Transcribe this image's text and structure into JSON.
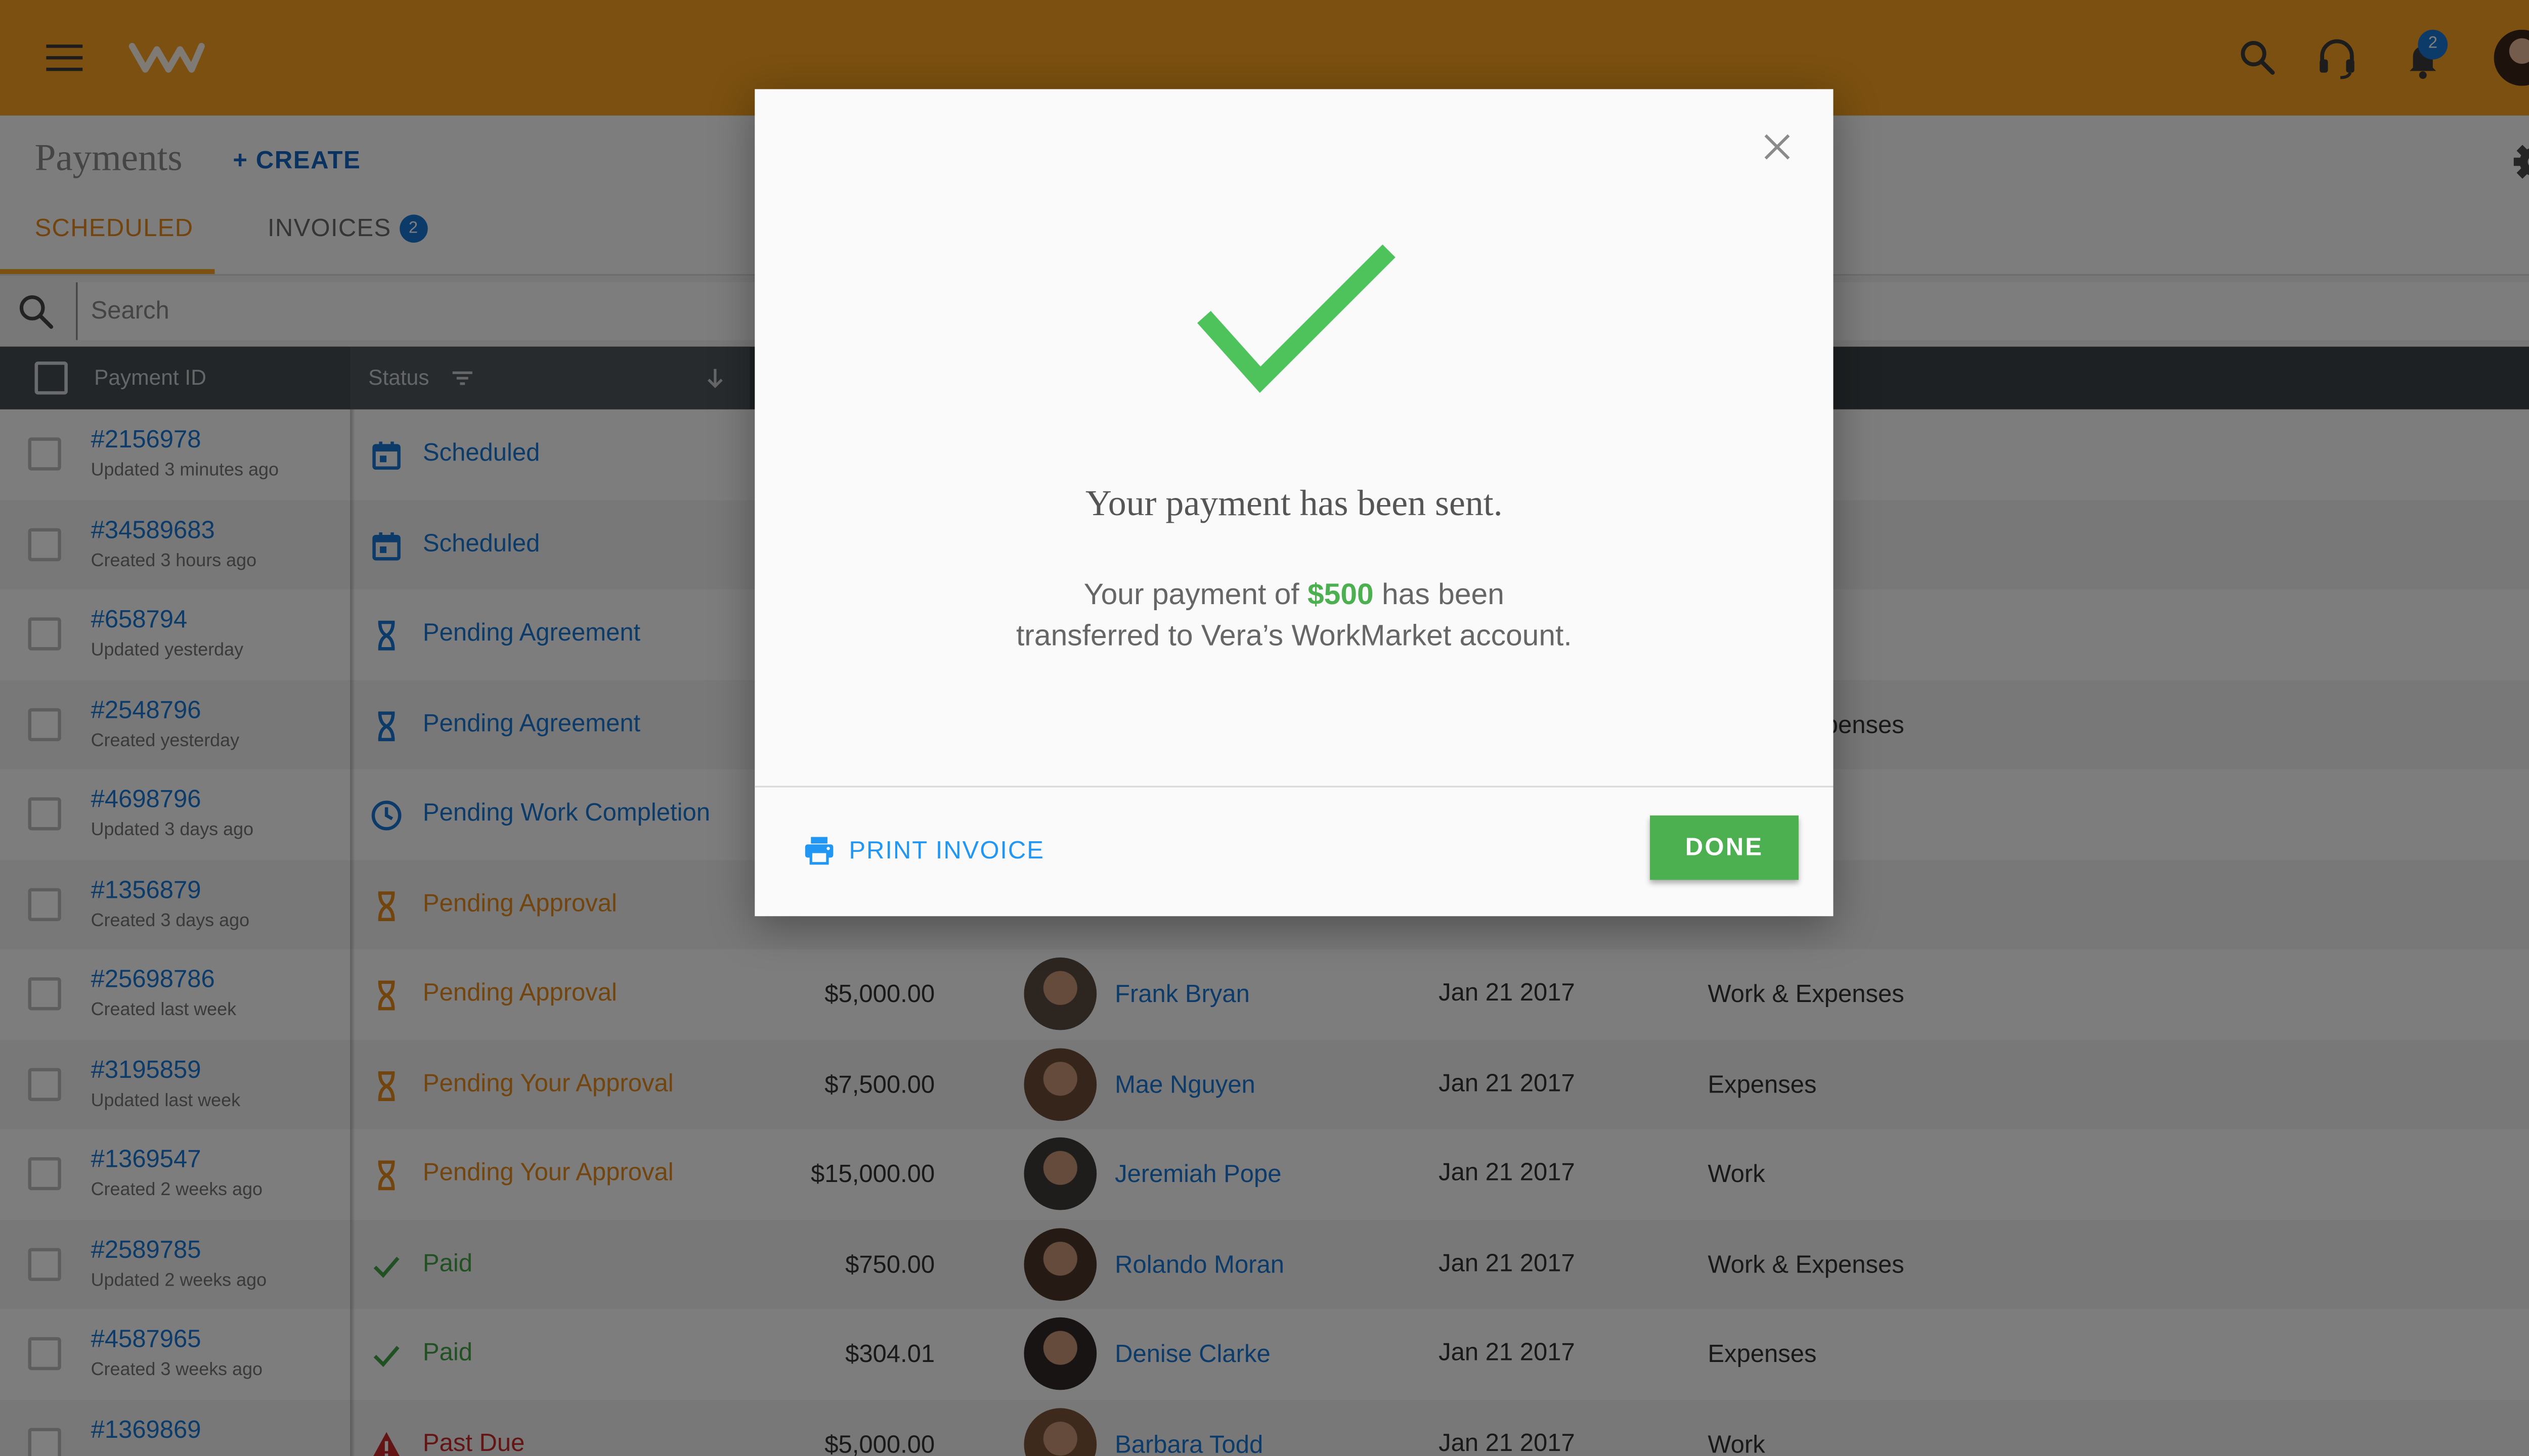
{
  "header": {
    "notification_count": "2"
  },
  "page": {
    "title": "Payments",
    "create_label": "+ CREATE"
  },
  "tabs": [
    {
      "label": "SCHEDULED"
    },
    {
      "label": "INVOICES",
      "badge": "2"
    }
  ],
  "search": {
    "placeholder": "Search"
  },
  "table": {
    "columns": {
      "payment_id": "Payment ID",
      "status": "Status"
    },
    "rows": [
      {
        "id": "#2156978",
        "sub": "Updated 3 minutes ago",
        "status": "Scheduled",
        "status_kind": "scheduled",
        "amount": "",
        "person": "",
        "date": "",
        "type": ""
      },
      {
        "id": "#34589683",
        "sub": "Created 3 hours ago",
        "status": "Scheduled",
        "status_kind": "scheduled",
        "amount": "",
        "person": "",
        "date": "",
        "type": ""
      },
      {
        "id": "#658794",
        "sub": "Updated yesterday",
        "status": "Pending Agreement",
        "status_kind": "pending-blue",
        "amount": "",
        "person": "",
        "date": "",
        "type": ""
      },
      {
        "id": "#2548796",
        "sub": "Created yesterday",
        "status": "Pending Agreement",
        "status_kind": "pending-blue",
        "amount": "",
        "person": "",
        "date": "",
        "type": "Work & Expenses"
      },
      {
        "id": "#4698796",
        "sub": "Updated 3 days ago",
        "status": "Pending Work Completion",
        "status_kind": "clock",
        "amount": "",
        "person": "",
        "date": "",
        "type": ""
      },
      {
        "id": "#1356879",
        "sub": "Created 3 days ago",
        "status": "Pending Approval",
        "status_kind": "pending-orange",
        "amount": "",
        "person": "",
        "date": "",
        "type": ""
      },
      {
        "id": "#25698786",
        "sub": "Created last week",
        "status": "Pending  Approval",
        "status_kind": "pending-orange",
        "amount": "$5,000.00",
        "person": "Frank Bryan",
        "date": "Jan 21 2017",
        "type": "Work & Expenses"
      },
      {
        "id": "#3195859",
        "sub": "Updated last week",
        "status": "Pending Your Approval",
        "status_kind": "pending-orange",
        "amount": "$7,500.00",
        "person": "Mae Nguyen",
        "date": "Jan 21 2017",
        "type": "Expenses"
      },
      {
        "id": "#1369547",
        "sub": "Created 2 weeks ago",
        "status": "Pending Your Approval",
        "status_kind": "pending-orange",
        "amount": "$15,000.00",
        "person": "Jeremiah Pope",
        "date": "Jan 21 2017",
        "type": "Work"
      },
      {
        "id": "#2589785",
        "sub": "Updated 2 weeks ago",
        "status": "Paid",
        "status_kind": "paid",
        "amount": "$750.00",
        "person": "Rolando Moran",
        "date": "Jan 21 2017",
        "type": "Work & Expenses"
      },
      {
        "id": "#4587965",
        "sub": "Created 3 weeks ago",
        "status": "Paid",
        "status_kind": "paid",
        "amount": "$304.01",
        "person": "Denise Clarke",
        "date": "Jan 21 2017",
        "type": "Expenses"
      },
      {
        "id": "#1369869",
        "sub": "",
        "status": "Past Due",
        "status_kind": "past-due",
        "amount": "$5,000.00",
        "person": "Barbara Todd",
        "date": "Jan 21 2017",
        "type": "Work"
      }
    ]
  },
  "modal": {
    "title": "Your payment has been sent.",
    "body_prefix": "Your payment of ",
    "body_amount": "$500",
    "body_suffix": " has been",
    "body_line2": "transferred to Vera’s WorkMarket account.",
    "print_label": "PRINT INVOICE",
    "done_label": "DONE"
  },
  "colors": {
    "brand": "#f7a121",
    "link": "#1976d2",
    "pending_orange": "#e5881d",
    "paid_green": "#43a047",
    "past_due_red": "#c62828",
    "done_green": "#4caf50"
  },
  "status_colors": {
    "scheduled": "#1976d2",
    "pending-blue": "#1976d2",
    "clock": "#1976d2",
    "pending-orange": "#e5881d",
    "paid": "#43a047",
    "past-due": "#c62828"
  }
}
